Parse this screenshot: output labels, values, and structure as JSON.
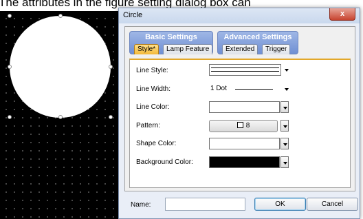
{
  "caption": "The attributes in the figure setting dialog box can",
  "dialog": {
    "title": "Circle",
    "close_label": "x",
    "groups": {
      "basic": "Basic Settings",
      "advanced": "Advanced Settings"
    },
    "tabs": [
      "Style*",
      "Lamp Feature",
      "Extended",
      "Trigger"
    ],
    "active_tab": "Style*",
    "fields": {
      "line_style": "Line Style:",
      "line_width": "Line Width:",
      "line_color": "Line Color:",
      "pattern": "Pattern:",
      "shape_color": "Shape Color:",
      "background_color": "Background Color:"
    },
    "values": {
      "line_width": "1 Dot",
      "pattern": "8",
      "line_color": "#ffffff",
      "shape_color": "#ffffff",
      "background_color": "#000000"
    },
    "name_label": "Name:",
    "name_value": "",
    "ok": "OK",
    "cancel": "Cancel"
  },
  "canvas": {
    "background": "#000000",
    "shape": "circle",
    "shape_fill": "#ffffff"
  },
  "icons": {
    "dropdown": "chevron-down-icon",
    "pattern_swatch": "square-icon",
    "close": "close-icon"
  }
}
